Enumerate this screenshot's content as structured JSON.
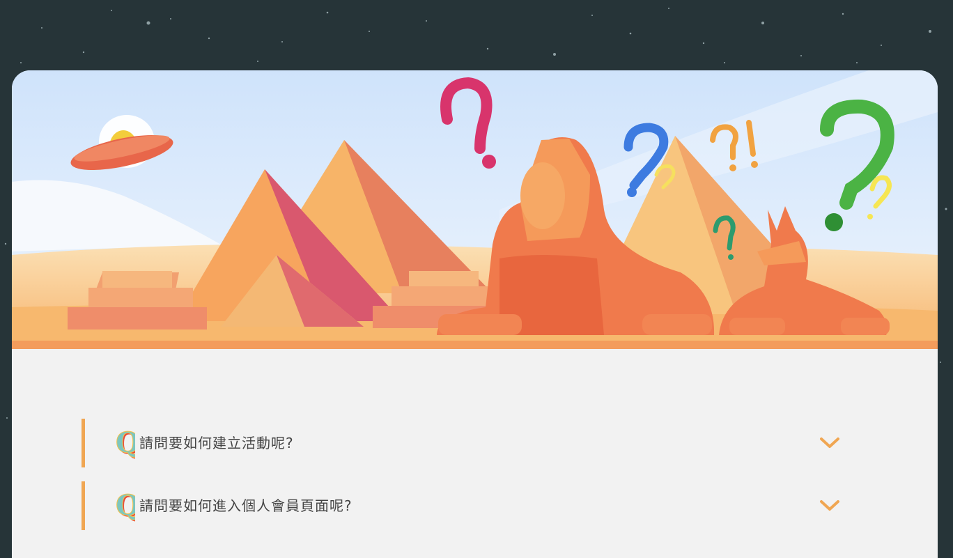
{
  "hero": {
    "illustration": "egypt-pyramids-sphinx-anubis-question-marks",
    "colors": {
      "sky": "#cfe5fb",
      "sand": "#f8c98a",
      "pyramid": "#f0955d",
      "sphinx": "#f07c4e"
    }
  },
  "faq": {
    "accent_color": "#f0a652",
    "items": [
      {
        "question": "請問要如何建立活動呢?",
        "icon": "q-badge-icon",
        "toggle_icon": "chevron-down-icon"
      },
      {
        "question": "請問要如何進入個人會員頁面呢?",
        "icon": "q-badge-icon",
        "toggle_icon": "chevron-down-icon"
      }
    ]
  }
}
